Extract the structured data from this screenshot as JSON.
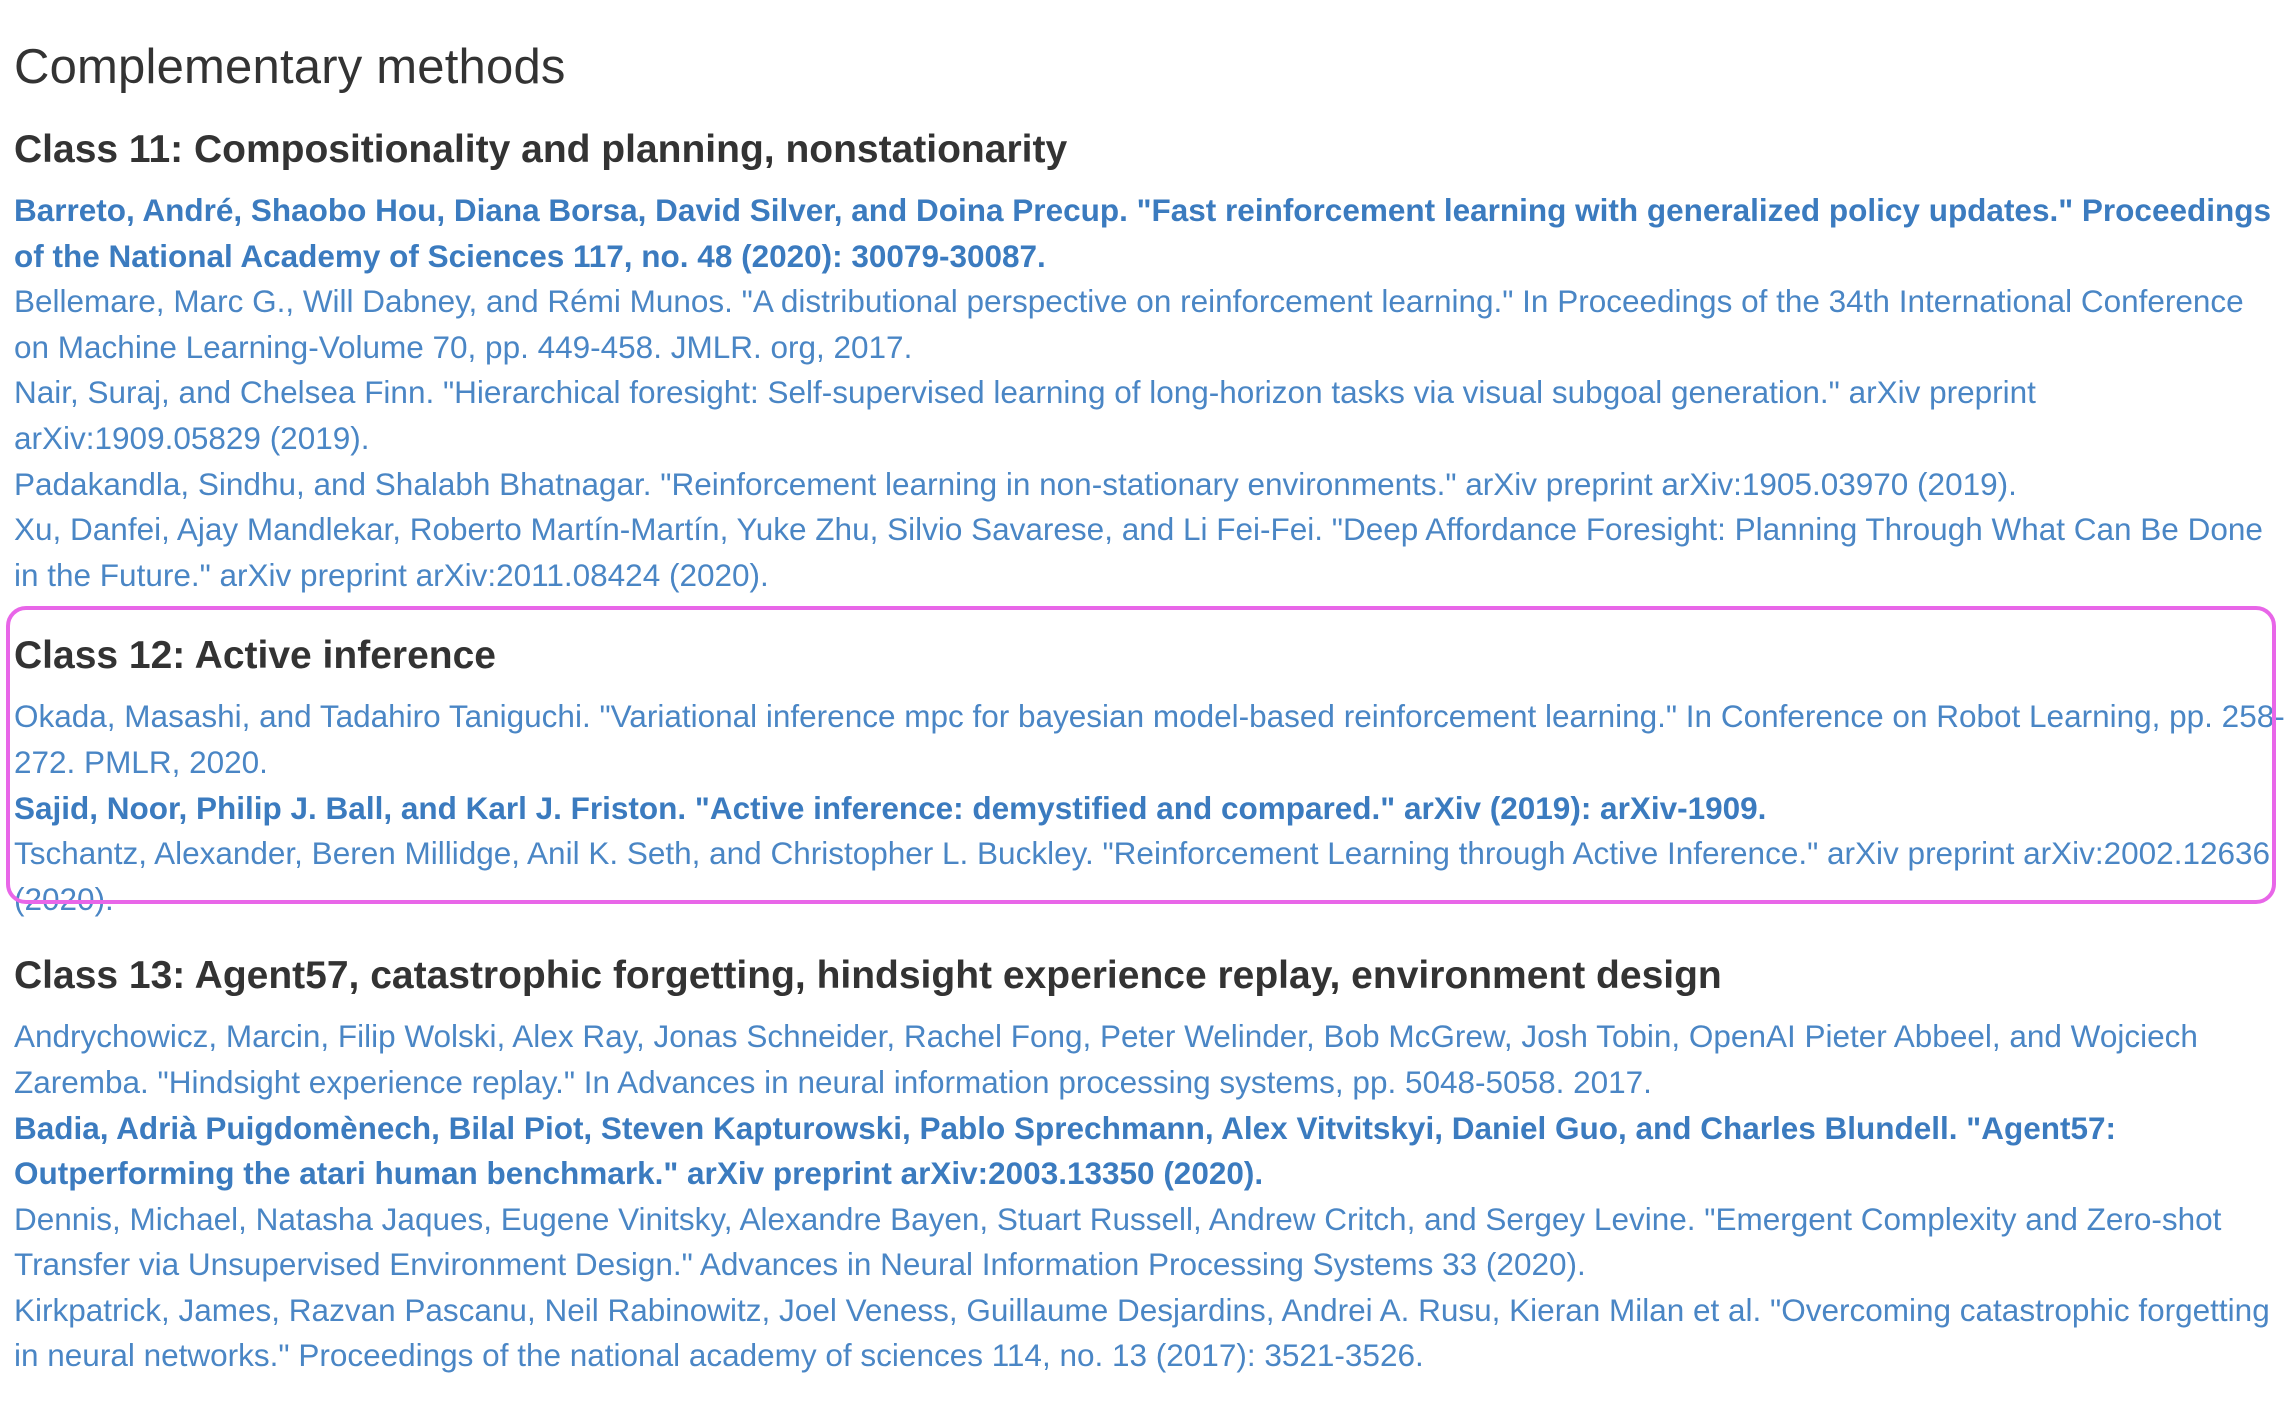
{
  "page": {
    "title": "Complementary methods"
  },
  "sections": [
    {
      "heading": "Class 11: Compositionality and planning, nonstationarity",
      "refs": [
        {
          "text": "Barreto, André, Shaobo Hou, Diana Borsa, David Silver, and Doina Precup. \"Fast reinforcement learning with generalized policy updates.\" Proceedings of the National Academy of Sciences 117, no. 48 (2020): 30079-30087.",
          "bold": true
        },
        {
          "text": "Bellemare, Marc G., Will Dabney, and Rémi Munos. \"A distributional perspective on reinforcement learning.\" In Proceedings of the 34th International Conference on Machine Learning-Volume 70, pp. 449-458. JMLR. org, 2017.",
          "bold": false
        },
        {
          "text": "Nair, Suraj, and Chelsea Finn. \"Hierarchical foresight: Self-supervised learning of long-horizon tasks via visual subgoal generation.\" arXiv preprint arXiv:1909.05829 (2019).",
          "bold": false
        },
        {
          "text": "Padakandla, Sindhu, and Shalabh Bhatnagar. \"Reinforcement learning in non-stationary environments.\" arXiv preprint arXiv:1905.03970 (2019).",
          "bold": false
        },
        {
          "text": "Xu, Danfei, Ajay Mandlekar, Roberto Martín-Martín, Yuke Zhu, Silvio Savarese, and Li Fei-Fei. \"Deep Affordance Foresight: Planning Through What Can Be Done in the Future.\" arXiv preprint arXiv:2011.08424 (2020).",
          "bold": false
        }
      ]
    },
    {
      "heading": "Class 12: Active inference",
      "highlighted": true,
      "highlight_color": "#e866e8",
      "refs": [
        {
          "text": "Okada, Masashi, and Tadahiro Taniguchi. \"Variational inference mpc for bayesian model-based reinforcement learning.\" In Conference on Robot Learning, pp. 258-272. PMLR, 2020.",
          "bold": false
        },
        {
          "text": "Sajid, Noor, Philip J. Ball, and Karl J. Friston. \"Active inference: demystified and compared.\" arXiv (2019): arXiv-1909.",
          "bold": true
        },
        {
          "text": "Tschantz, Alexander, Beren Millidge, Anil K. Seth, and Christopher L. Buckley. \"Reinforcement Learning through Active Inference.\" arXiv preprint arXiv:2002.12636 (2020).",
          "bold": false
        }
      ]
    },
    {
      "heading": "Class 13: Agent57, catastrophic forgetting, hindsight experience replay, environment design",
      "refs": [
        {
          "text": "Andrychowicz, Marcin, Filip Wolski, Alex Ray, Jonas Schneider, Rachel Fong, Peter Welinder, Bob McGrew, Josh Tobin, OpenAI Pieter Abbeel, and Wojciech Zaremba. \"Hindsight experience replay.\" In Advances in neural information processing systems, pp. 5048-5058. 2017.",
          "bold": false
        },
        {
          "text": "Badia, Adrià Puigdomènech, Bilal Piot, Steven Kapturowski, Pablo Sprechmann, Alex Vitvitskyi, Daniel Guo, and Charles Blundell. \"Agent57: Outperforming the atari human benchmark.\" arXiv preprint arXiv:2003.13350 (2020).",
          "bold": true
        },
        {
          "text": "Dennis, Michael, Natasha Jaques, Eugene Vinitsky, Alexandre Bayen, Stuart Russell, Andrew Critch, and Sergey Levine. \"Emergent Complexity and Zero-shot Transfer via Unsupervised Environment Design.\" Advances in Neural Information Processing Systems 33 (2020).",
          "bold": false
        },
        {
          "text": "Kirkpatrick, James, Razvan Pascanu, Neil Rabinowitz, Joel Veness, Guillaume Desjardins, Andrei A. Rusu, Kieran Milan et al. \"Overcoming catastrophic forgetting in neural networks.\" Proceedings of the national academy of sciences 114, no. 13 (2017): 3521-3526.",
          "bold": false
        }
      ]
    }
  ],
  "colors": {
    "link": "#4a86c5",
    "link_bold": "#3b7bbf",
    "heading": "#333333"
  }
}
